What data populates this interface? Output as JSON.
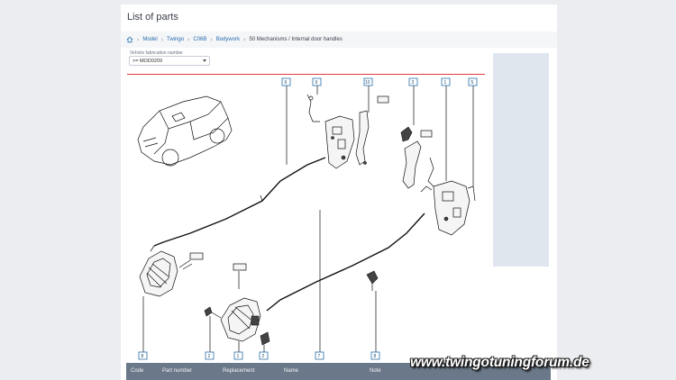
{
  "page": {
    "title": "List of parts"
  },
  "breadcrumb": {
    "items": [
      {
        "label": "Model",
        "link": true
      },
      {
        "label": "Twingo",
        "link": true
      },
      {
        "label": "C06B",
        "link": true
      },
      {
        "label": "Bodywork",
        "link": true
      },
      {
        "label": "50 Mechanisms / Internal door handles",
        "link": false
      }
    ]
  },
  "filter": {
    "label": "Vehicle fabrication number",
    "value": ">= MOD0209"
  },
  "diagram": {
    "callouts": [
      "6",
      "9",
      "10",
      "3",
      "1",
      "5",
      "8",
      "2",
      "1",
      "2",
      "7",
      "8"
    ]
  },
  "table": {
    "columns": [
      "Code",
      "Part number",
      "Replacement",
      "Name",
      "Note"
    ]
  },
  "watermark": {
    "text": "www.twingotuningforum.de"
  },
  "colors": {
    "accent_line": "#e23b3b",
    "link": "#2b6cb0",
    "table_header": "#6b7889"
  }
}
